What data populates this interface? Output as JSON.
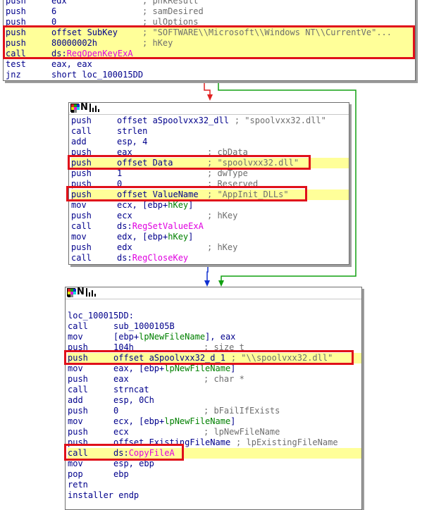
{
  "nodes": {
    "top": {
      "lines": [
        {
          "mn": "push",
          "op": "edx",
          "cm": "; phkResult"
        },
        {
          "mn": "push",
          "op": "6",
          "cm": "; samDesired"
        },
        {
          "mn": "push",
          "op": "0",
          "cm": "; ulOptions"
        },
        {
          "mn": "push",
          "op": "offset SubKey",
          "cm": "; \"SOFTWARE\\\\Microsoft\\\\Windows NT\\\\CurrentVe\"...",
          "hl": true
        },
        {
          "mn": "push",
          "op": "80000002h",
          "cm": "; hKey",
          "hl": true
        },
        {
          "mn": "call",
          "op": "ds:",
          "op2": "RegOpenKeyExA",
          "hl": true
        },
        {
          "mn": "test",
          "op": "eax, eax",
          "cm": ""
        },
        {
          "mn": "jnz",
          "op": "short loc_100015DD",
          "cm": ""
        }
      ]
    },
    "mid": {
      "lines": [
        {
          "mn": "push",
          "op": "offset aSpoolvxx32_dll",
          "cm": "; \"spoolvxx32.dll\""
        },
        {
          "mn": "call",
          "op": "strlen",
          "cm": ""
        },
        {
          "mn": "add",
          "op": "esp, 4",
          "cm": ""
        },
        {
          "mn": "push",
          "op": "eax",
          "cm": "; cbData"
        },
        {
          "mn": "push",
          "op": "offset Data",
          "cm": "; \"spoolvxx32.dll\"",
          "hl": true
        },
        {
          "mn": "push",
          "op": "1",
          "cm": "; dwType"
        },
        {
          "mn": "push",
          "op": "0",
          "cm": "; Reserved"
        },
        {
          "mn": "push",
          "op": "offset ValueName",
          "cm": "; \"AppInit_DLLs\"",
          "hl": true
        },
        {
          "mn": "mov",
          "op": "ecx, [ebp+",
          "op2": "hKey",
          "op3": "]",
          "cm": ""
        },
        {
          "mn": "push",
          "op": "ecx",
          "cm": "; hKey"
        },
        {
          "mn": "call",
          "op": "ds:",
          "op2": "RegSetValueExA",
          "cm": ""
        },
        {
          "mn": "mov",
          "op": "edx, [ebp+",
          "op2": "hKey",
          "op3": "]",
          "cm": ""
        },
        {
          "mn": "push",
          "op": "edx",
          "cm": "; hKey"
        },
        {
          "mn": "call",
          "op": "ds:",
          "op2": "RegCloseKey",
          "cm": ""
        }
      ]
    },
    "bot": {
      "lines": [
        {
          "mn": "",
          "op": "",
          "cm": ""
        },
        {
          "label": "loc_100015DD:"
        },
        {
          "mn": "call",
          "op": "sub_1000105B",
          "cm": ""
        },
        {
          "mn": "mov",
          "op": "[ebp+",
          "op2": "lpNewFileName",
          "op3": "], eax",
          "cm": ""
        },
        {
          "mn": "push",
          "op": "104h",
          "cm": "; size_t"
        },
        {
          "mn": "push",
          "op": "offset aSpoolvxx32_d_1",
          "cm": "; \"\\\\spoolvxx32.dll\"",
          "hl": true
        },
        {
          "mn": "mov",
          "op": "eax, [ebp+",
          "op2": "lpNewFileName",
          "op3": "]",
          "cm": ""
        },
        {
          "mn": "push",
          "op": "eax",
          "cm": "; char *"
        },
        {
          "mn": "call",
          "op": "strncat",
          "cm": ""
        },
        {
          "mn": "add",
          "op": "esp, 0Ch",
          "cm": ""
        },
        {
          "mn": "push",
          "op": "0",
          "cm": "; bFailIfExists"
        },
        {
          "mn": "mov",
          "op": "ecx, [ebp+",
          "op2": "lpNewFileName",
          "op3": "]",
          "cm": ""
        },
        {
          "mn": "push",
          "op": "ecx",
          "cm": "; lpNewFileName"
        },
        {
          "mn": "push",
          "op": "offset ExistingFileName",
          "cm": "; lpExistingFileName"
        },
        {
          "mn": "call",
          "op": "ds:",
          "op2": "CopyFileA",
          "hl": true
        },
        {
          "mn": "mov",
          "op": "esp, ebp",
          "cm": ""
        },
        {
          "mn": "pop",
          "op": "ebp",
          "cm": ""
        },
        {
          "mn": "retn",
          "op": "",
          "cm": ""
        },
        {
          "label": "installer endp"
        }
      ]
    }
  },
  "colors": {
    "highlight_box": "#e0101a",
    "line_highlight": "#ffff99",
    "edge_taken": "#e02020",
    "edge_fallthrough": "#10a010",
    "edge_unconditional": "#1030d0"
  }
}
